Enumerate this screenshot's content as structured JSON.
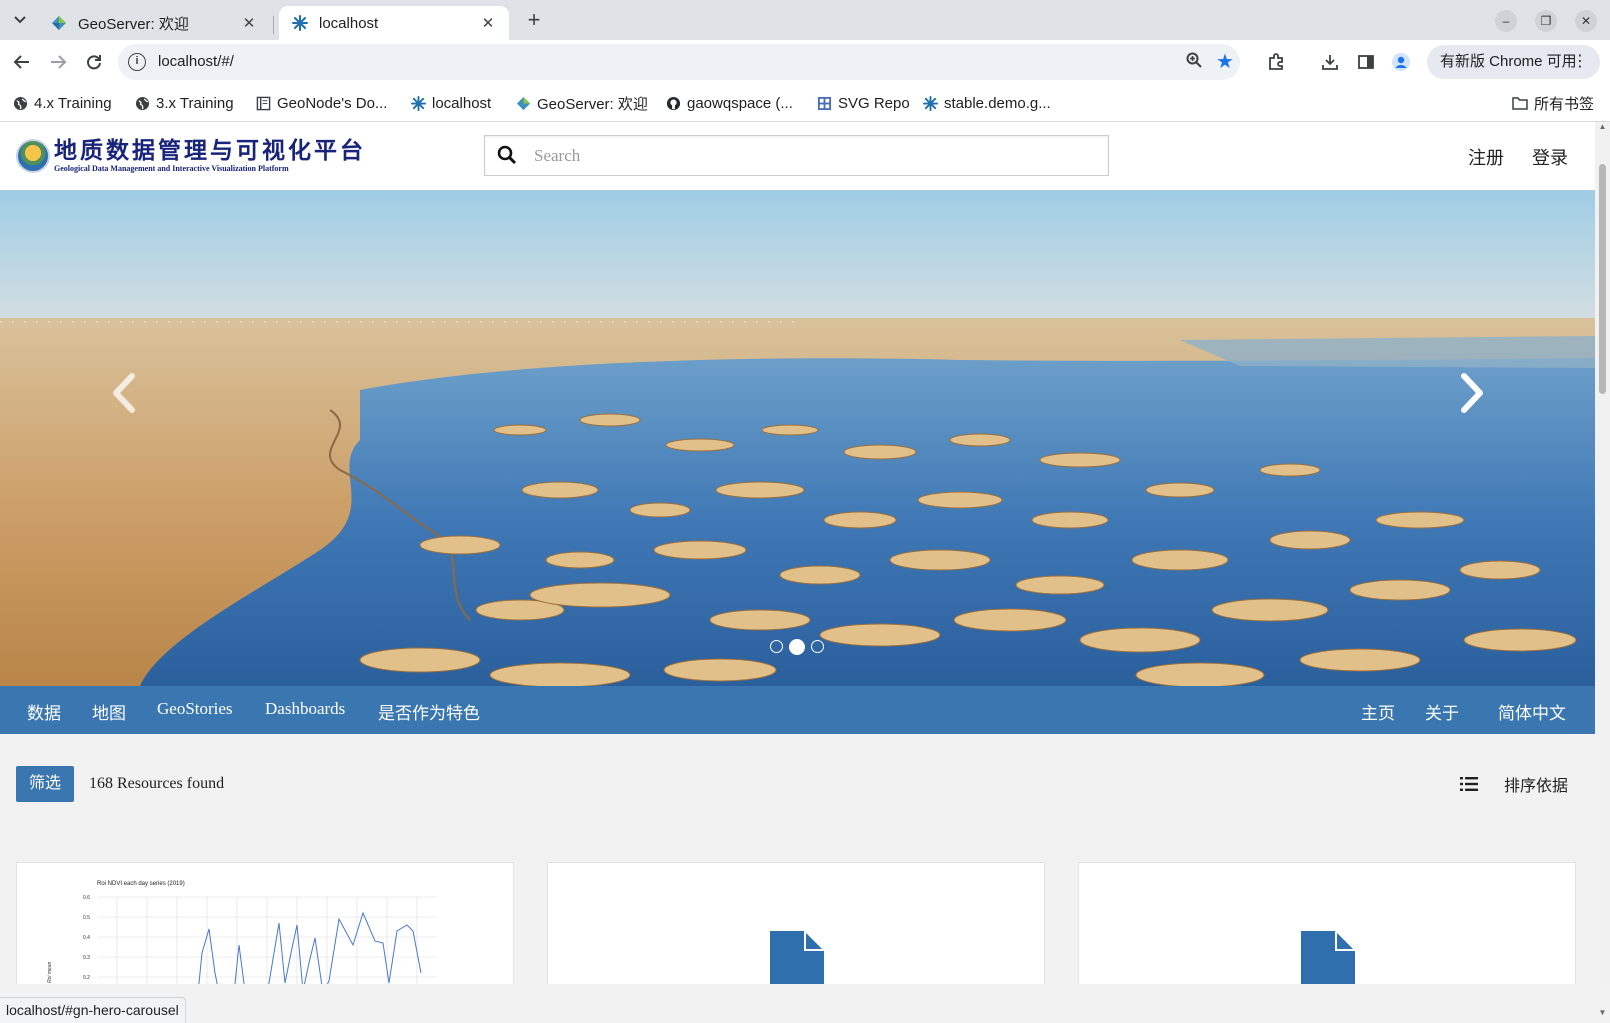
{
  "browser": {
    "tabs": [
      {
        "title": "GeoServer: 欢迎",
        "close": "✕"
      },
      {
        "title": "localhost",
        "close": "✕"
      }
    ],
    "new_tab": "+",
    "url": "localhost/#/",
    "update_pill": "有新版 Chrome 可用",
    "window_controls": {
      "minimize": "–",
      "restore": "❐",
      "close": "✕"
    },
    "bookmarks": [
      {
        "label": "4.x Training",
        "icon": "globe-icon"
      },
      {
        "label": "3.x Training",
        "icon": "globe-icon"
      },
      {
        "label": "GeoNode's Do...",
        "icon": "book-icon"
      },
      {
        "label": "localhost",
        "icon": "geonode-icon"
      },
      {
        "label": "GeoServer: 欢迎",
        "icon": "geoserver-icon"
      },
      {
        "label": "gaowqspace (...",
        "icon": "github-icon"
      },
      {
        "label": "SVG Repo",
        "icon": "svgrepo-icon"
      },
      {
        "label": "stable.demo.g...",
        "icon": "geonode-icon"
      }
    ],
    "all_bookmarks": "所有书签",
    "status_url": "localhost/#gn-hero-carousel"
  },
  "site": {
    "logo_cn": "地质数据管理与可视化平台",
    "logo_en": "Geological Data Management and Interactive Visualization Platform",
    "search_placeholder": "Search",
    "register": "注册",
    "login": "登录",
    "hero": {
      "slides": 3,
      "active_slide": 2
    },
    "nav_left": [
      "数据",
      "地图",
      "GeoStories",
      "Dashboards",
      "是否作为特色"
    ],
    "nav_right": [
      "主页",
      "关于",
      "简体中文"
    ],
    "filter_button": "筛选",
    "resources_found": "168 Resources found",
    "sort_label": "排序依据",
    "cards": [
      {
        "type": "chart-thumbnail",
        "title": "Roi NDVI each day series (2019)",
        "ylabel": "Roi mean",
        "yticks": [
          "0.6",
          "0.5",
          "0.4",
          "0.3",
          "0.2"
        ]
      },
      {
        "type": "document-icon"
      },
      {
        "type": "document-icon"
      }
    ]
  },
  "colors": {
    "nav_blue": "#3a76b0",
    "accent_blue": "#1a73e8",
    "logo_navy": "#18237a"
  }
}
